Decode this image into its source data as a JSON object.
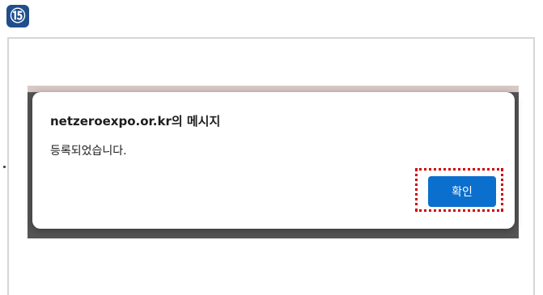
{
  "step_badge": {
    "label": "⑮",
    "color": "#1f4e8c"
  },
  "dialog": {
    "title": "netzeroexpo.or.kr의 메시지",
    "message": "등록되었습니다.",
    "ok_label": "확인",
    "ok_color": "#0b6fce"
  },
  "highlight": {
    "target": "ok-button",
    "color": "#d10000",
    "style": "dotted"
  }
}
